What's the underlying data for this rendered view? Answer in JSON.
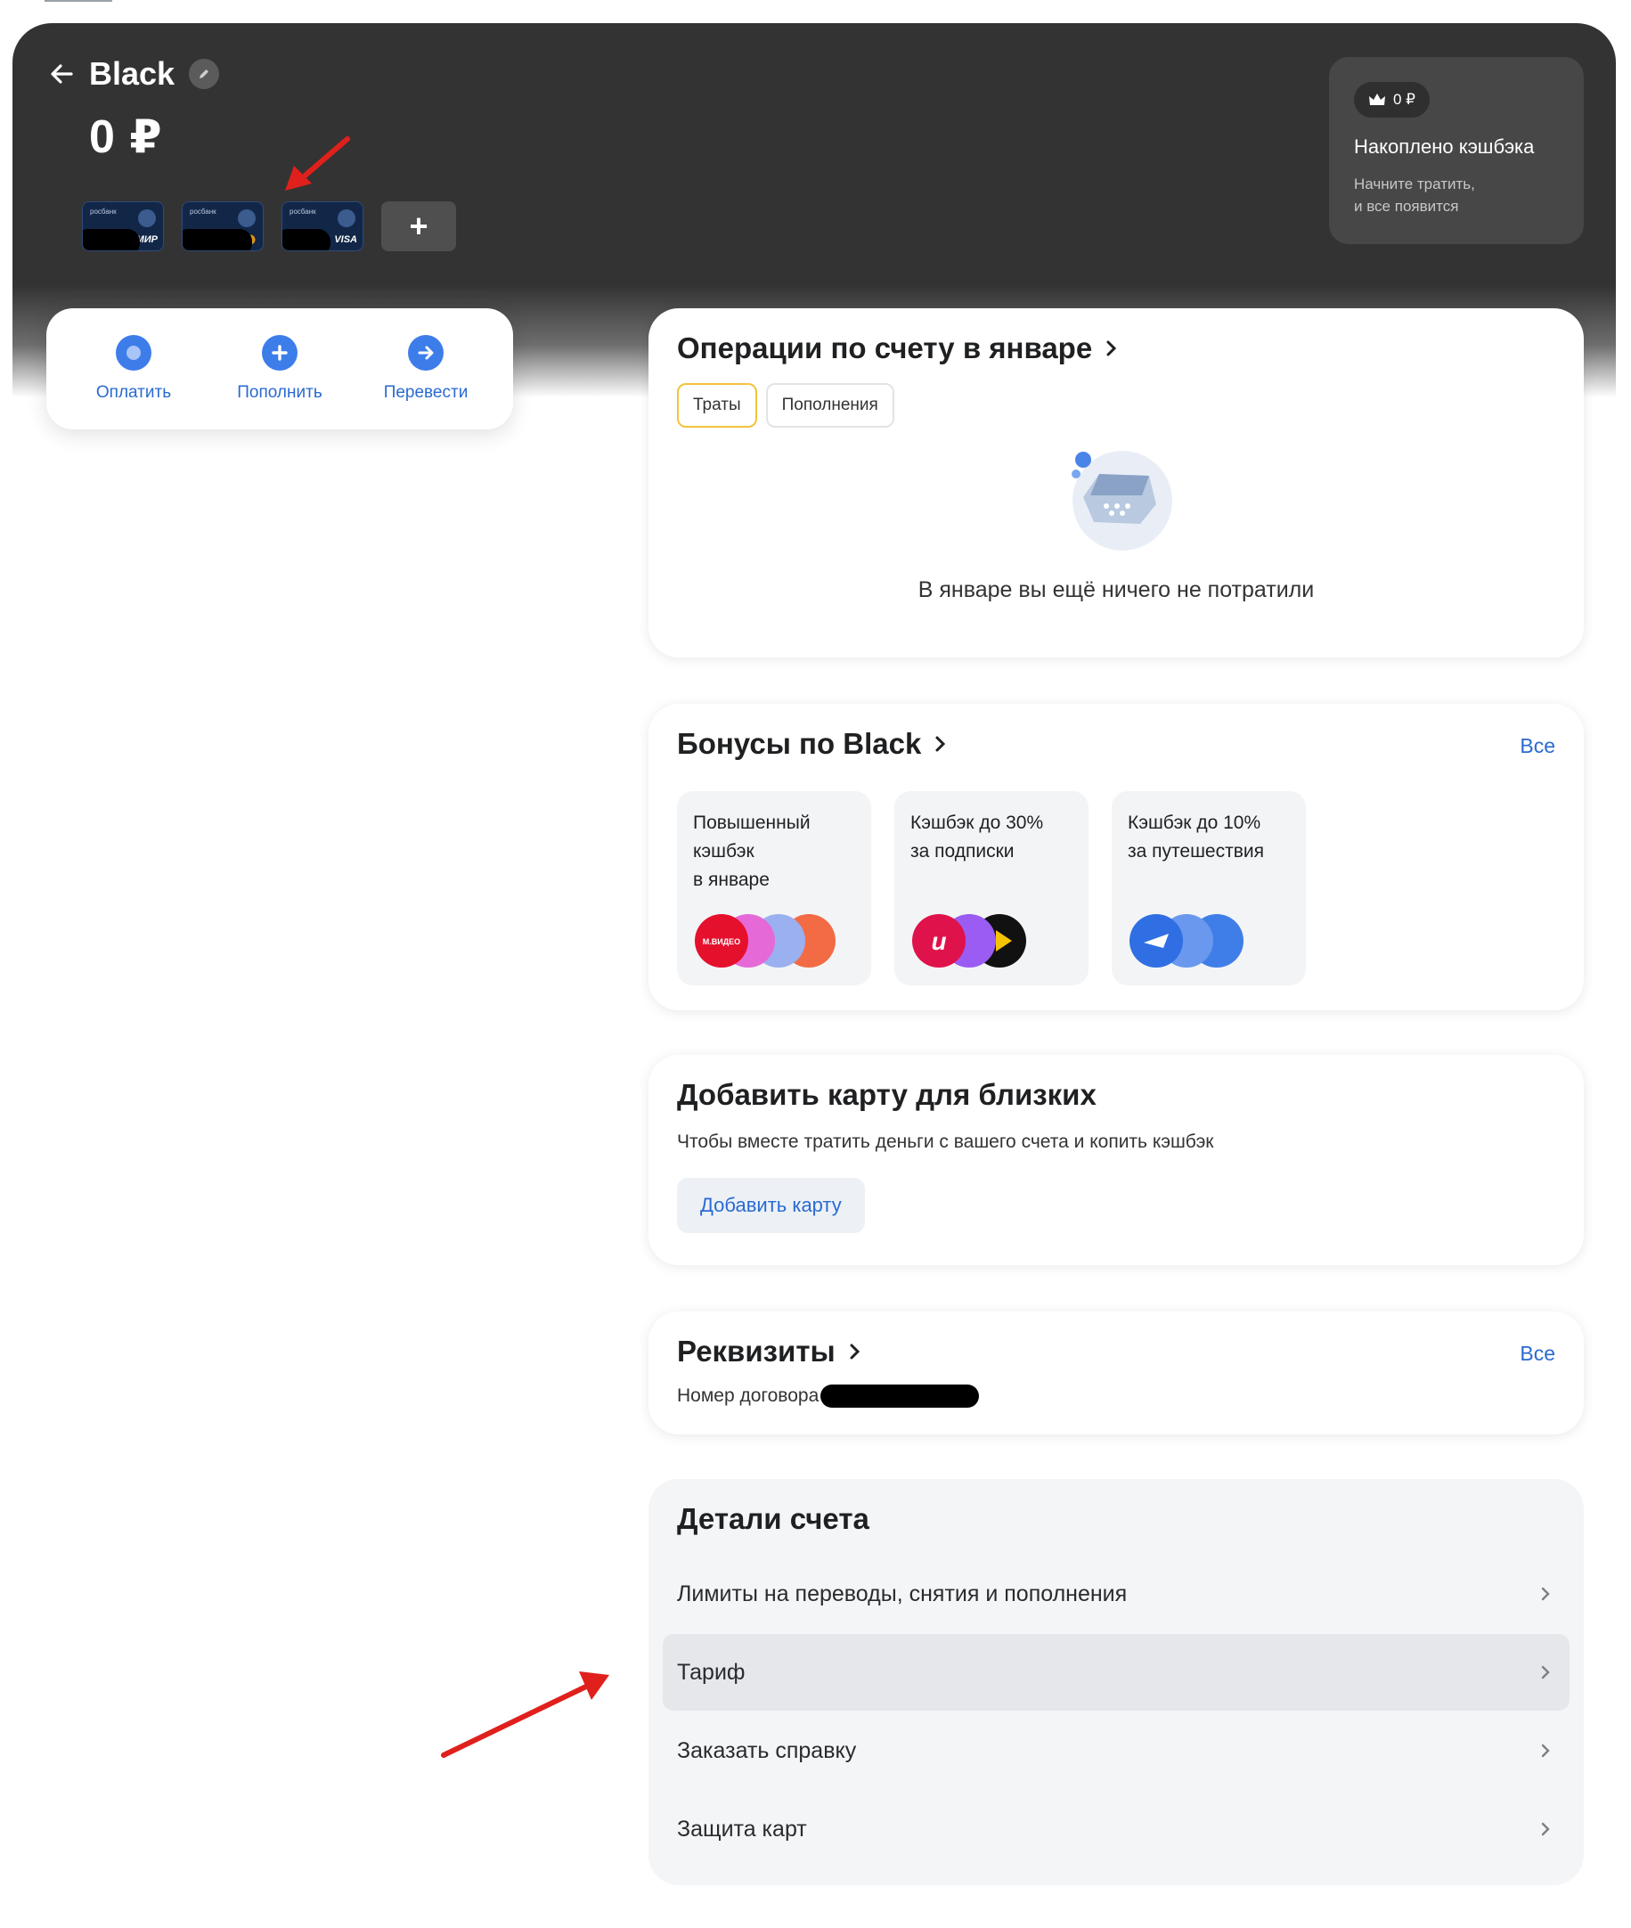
{
  "account": {
    "name": "Black",
    "balance": "0 ₽"
  },
  "cards": [
    {
      "system": "МИР",
      "bank": "росбанк"
    },
    {
      "system": "Mastercard",
      "bank": "росбанк"
    },
    {
      "system": "VISA",
      "bank": "росбанк"
    }
  ],
  "add_card_symbol": "+",
  "cashback": {
    "badge": "0 ₽",
    "title": "Накоплено кэшбэка",
    "subtitle": "Начните тратить,\nи все появится"
  },
  "actions": [
    {
      "label": "Оплатить",
      "icon": "pay-icon"
    },
    {
      "label": "Пополнить",
      "icon": "plus-icon"
    },
    {
      "label": "Перевести",
      "icon": "transfer-icon"
    }
  ],
  "operations": {
    "title": "Операции по счету в январе",
    "tabs": [
      "Траты",
      "Пополнения"
    ],
    "active_tab": "Траты",
    "empty_text": "В январе вы ещё ничего не потратили"
  },
  "bonuses": {
    "title": "Бонусы по Black",
    "all_link": "Все",
    "items": [
      {
        "text": "Повышенный\nкэшбэк\nв январе",
        "logos": [
          "mvideo-logo",
          "pink-logo",
          "blue-logo",
          "orange-logo"
        ]
      },
      {
        "text": "Кэшбэк до 30%\nза подписки",
        "logos": [
          "ivi-logo",
          "music-logo",
          "play-logo"
        ]
      },
      {
        "text": "Кэшбэк до 10%\nза путешествия",
        "logos": [
          "plane-logo",
          "hotel-logo",
          "pin-logo"
        ]
      }
    ]
  },
  "family": {
    "title": "Добавить карту для близких",
    "subtitle": "Чтобы вместе тратить деньги с вашего счета и копить кэшбэк",
    "button": "Добавить карту"
  },
  "requisites": {
    "title": "Реквизиты",
    "all_link": "Все",
    "contract_label": "Номер договора"
  },
  "details": {
    "title": "Детали счета",
    "rows": [
      "Лимиты на переводы, снятия и пополнения",
      "Тариф",
      "Заказать справку",
      "Защита карт"
    ],
    "highlighted": "Тариф"
  },
  "colors": {
    "header_bg": "#333333",
    "accent_blue": "#2a6ad1",
    "action_icon": "#3d7dea",
    "active_tab_border": "#f3c23c",
    "annotation_arrow": "#e0201c"
  }
}
